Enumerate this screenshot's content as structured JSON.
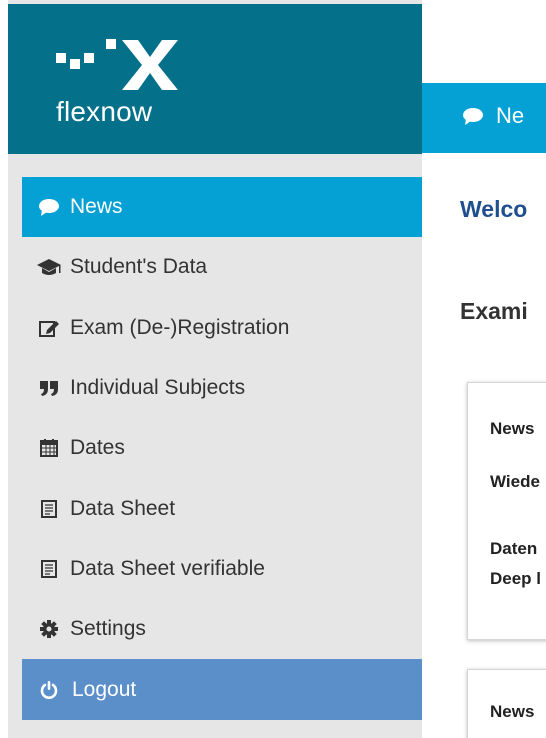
{
  "brand": {
    "logo_text": "flexnow"
  },
  "menu": {
    "items": [
      {
        "label": "News",
        "icon": "comment-icon"
      },
      {
        "label": "Student's Data",
        "icon": "graduation-cap-icon"
      },
      {
        "label": "Exam (De-)Registration",
        "icon": "edit-icon"
      },
      {
        "label": "Individual Subjects",
        "icon": "quote-icon"
      },
      {
        "label": "Dates",
        "icon": "calendar-icon"
      },
      {
        "label": "Data Sheet",
        "icon": "document-icon"
      },
      {
        "label": "Data Sheet verifiable",
        "icon": "document-icon"
      },
      {
        "label": "Settings",
        "icon": "cog-icon"
      }
    ],
    "logout_label": "Logout"
  },
  "header": {
    "label": "Ne"
  },
  "main": {
    "welcome": "Welco",
    "exam_heading": "Exami",
    "card1": {
      "line1": "News",
      "line2": "Wiede",
      "line3": "Daten",
      "line4": "Deep l"
    },
    "card2": {
      "line1": "News"
    }
  },
  "colors": {
    "brand_bg": "#04708a",
    "active_bg": "#05a0d4",
    "logout_bg": "#5b8fca",
    "sidebar_bg": "#e6e6e6",
    "welcome_text": "#1f4f8f"
  }
}
